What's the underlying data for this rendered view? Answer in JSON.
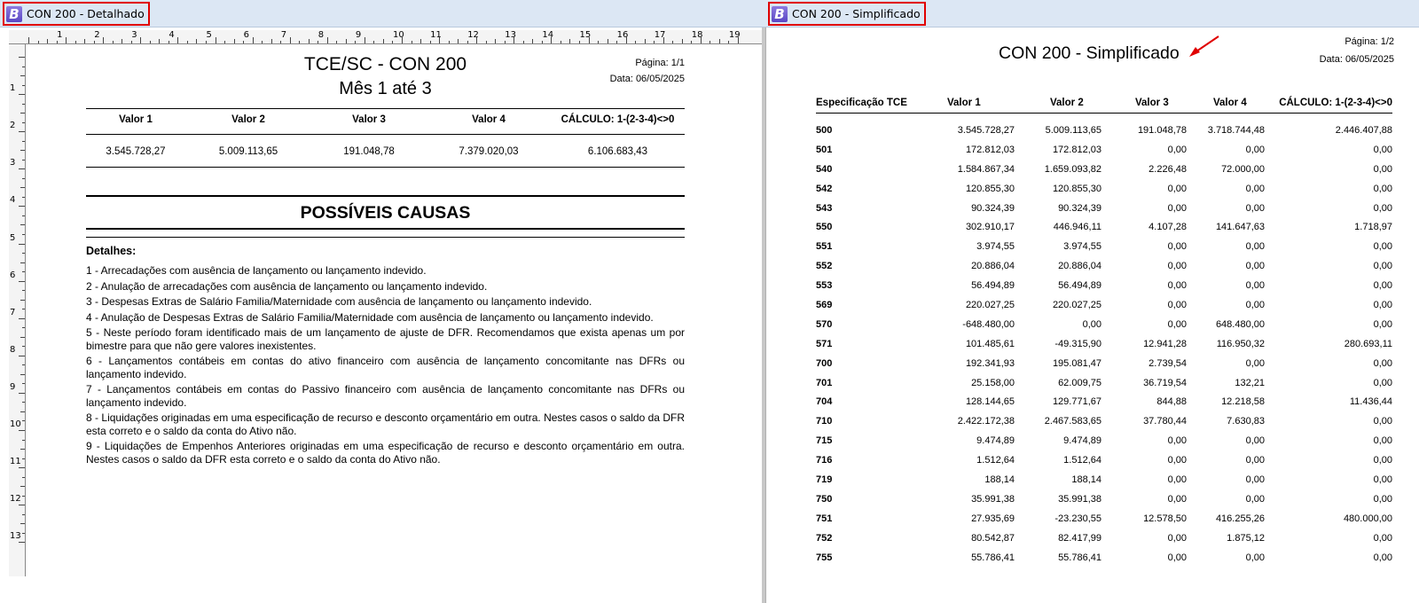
{
  "windows": {
    "left_title": "CON 200 - Detalhado",
    "right_title": "CON 200 - Simplificado",
    "logo_letter": "B"
  },
  "ruler": {
    "h_numbers": [
      "1",
      "2",
      "3",
      "4",
      "5",
      "6",
      "7",
      "8",
      "9",
      "10",
      "11",
      "12",
      "13",
      "14",
      "15",
      "16",
      "17",
      "18",
      "19"
    ],
    "v_numbers": [
      "1",
      "2",
      "3",
      "4",
      "5",
      "6",
      "7",
      "8",
      "9",
      "10",
      "11",
      "12",
      "13"
    ]
  },
  "detalhado": {
    "title_line1": "TCE/SC - CON 200",
    "title_line2": "Mês 1 até 3",
    "page": "Página: 1/1",
    "date": "Data: 06/05/2025",
    "headers": [
      "Valor 1",
      "Valor 2",
      "Valor 3",
      "Valor 4",
      "CÁLCULO: 1-(2-3-4)<>0"
    ],
    "values": [
      "3.545.728,27",
      "5.009.113,65",
      "191.048,78",
      "7.379.020,03",
      "6.106.683,43"
    ],
    "causes_title": "POSSÍVEIS CAUSAS",
    "details_label": "Detalhes:",
    "causes": [
      "1 - Arrecadações com ausência de lançamento ou lançamento indevido.",
      "2 - Anulação de arrecadações com ausência de lançamento ou lançamento indevido.",
      "3 - Despesas Extras de Salário Familia/Maternidade com ausência de lançamento ou lançamento indevido.",
      "4 - Anulação de Despesas Extras de Salário Familia/Maternidade com ausência de lançamento ou lançamento indevido.",
      "5 - Neste período foram identificado mais de um lançamento de ajuste de DFR. Recomendamos que exista apenas um por bimestre para que não gere valores inexistentes.",
      "6 - Lançamentos contábeis em contas do ativo financeiro com ausência de lançamento concomitante nas DFRs ou lançamento indevido.",
      "7 - Lançamentos contábeis em contas do Passivo financeiro com ausência de lançamento concomitante nas DFRs ou lançamento indevido.",
      "8 - Liquidações originadas em uma especificação de recurso e desconto orçamentário em outra. Nestes casos o saldo da DFR esta correto e o saldo da conta do Ativo não.",
      "9 - Liquidações  de Empenhos Anteriores originadas em uma especificação de recurso e desconto orçamentário em outra. Nestes casos o saldo da DFR esta correto e o saldo da conta do Ativo não."
    ]
  },
  "simplificado": {
    "title": "CON 200 - Simplificado",
    "page": "Página: 1/2",
    "date": "Data: 06/05/2025",
    "headers": [
      "Especificação TCE",
      "Valor 1",
      "Valor 2",
      "Valor 3",
      "Valor 4",
      "CÁLCULO: 1-(2-3-4)<>0"
    ],
    "rows": [
      [
        "500",
        "3.545.728,27",
        "5.009.113,65",
        "191.048,78",
        "3.718.744,48",
        "2.446.407,88"
      ],
      [
        "501",
        "172.812,03",
        "172.812,03",
        "0,00",
        "0,00",
        "0,00"
      ],
      [
        "540",
        "1.584.867,34",
        "1.659.093,82",
        "2.226,48",
        "72.000,00",
        "0,00"
      ],
      [
        "542",
        "120.855,30",
        "120.855,30",
        "0,00",
        "0,00",
        "0,00"
      ],
      [
        "543",
        "90.324,39",
        "90.324,39",
        "0,00",
        "0,00",
        "0,00"
      ],
      [
        "550",
        "302.910,17",
        "446.946,11",
        "4.107,28",
        "141.647,63",
        "1.718,97"
      ],
      [
        "551",
        "3.974,55",
        "3.974,55",
        "0,00",
        "0,00",
        "0,00"
      ],
      [
        "552",
        "20.886,04",
        "20.886,04",
        "0,00",
        "0,00",
        "0,00"
      ],
      [
        "553",
        "56.494,89",
        "56.494,89",
        "0,00",
        "0,00",
        "0,00"
      ],
      [
        "569",
        "220.027,25",
        "220.027,25",
        "0,00",
        "0,00",
        "0,00"
      ],
      [
        "570",
        "-648.480,00",
        "0,00",
        "0,00",
        "648.480,00",
        "0,00"
      ],
      [
        "571",
        "101.485,61",
        "-49.315,90",
        "12.941,28",
        "116.950,32",
        "280.693,11"
      ],
      [
        "700",
        "192.341,93",
        "195.081,47",
        "2.739,54",
        "0,00",
        "0,00"
      ],
      [
        "701",
        "25.158,00",
        "62.009,75",
        "36.719,54",
        "132,21",
        "0,00"
      ],
      [
        "704",
        "128.144,65",
        "129.771,67",
        "844,88",
        "12.218,58",
        "11.436,44"
      ],
      [
        "710",
        "2.422.172,38",
        "2.467.583,65",
        "37.780,44",
        "7.630,83",
        "0,00"
      ],
      [
        "715",
        "9.474,89",
        "9.474,89",
        "0,00",
        "0,00",
        "0,00"
      ],
      [
        "716",
        "1.512,64",
        "1.512,64",
        "0,00",
        "0,00",
        "0,00"
      ],
      [
        "719",
        "188,14",
        "188,14",
        "0,00",
        "0,00",
        "0,00"
      ],
      [
        "750",
        "35.991,38",
        "35.991,38",
        "0,00",
        "0,00",
        "0,00"
      ],
      [
        "751",
        "27.935,69",
        "-23.230,55",
        "12.578,50",
        "416.255,26",
        "480.000,00"
      ],
      [
        "752",
        "80.542,87",
        "82.417,99",
        "0,00",
        "1.875,12",
        "0,00"
      ],
      [
        "755",
        "55.786,41",
        "55.786,41",
        "0,00",
        "0,00",
        "0,00"
      ]
    ]
  },
  "colors": {
    "highlight_border": "#e00000",
    "logo": "#6a57d0",
    "titlebar": "#dce7f4"
  }
}
